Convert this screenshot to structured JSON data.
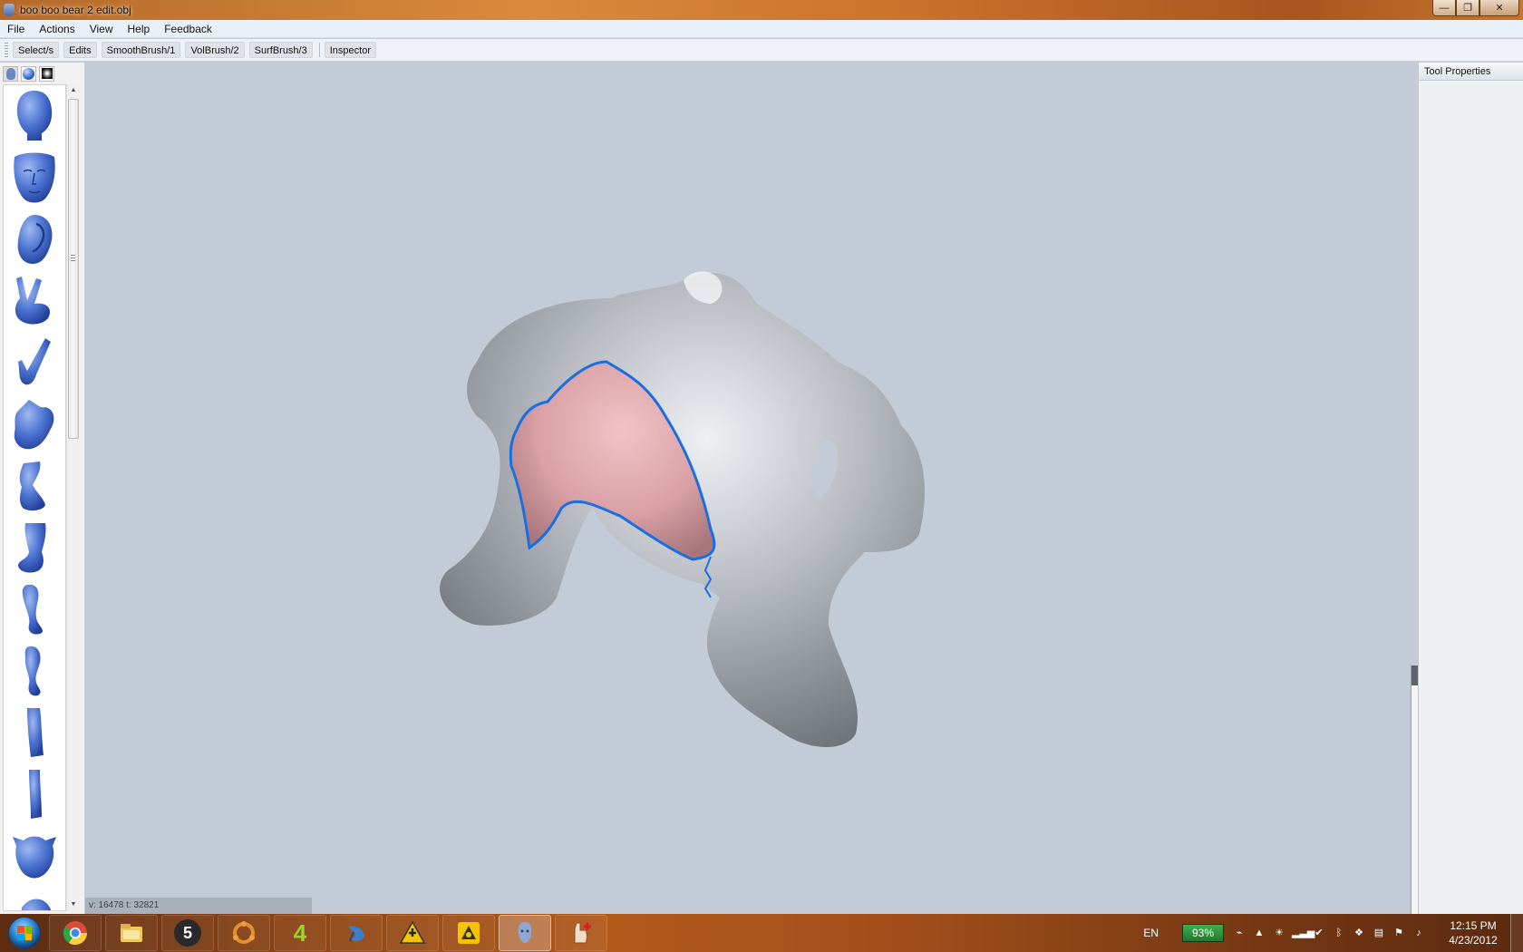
{
  "window": {
    "title": "boo boo bear 2 edit.obj",
    "minimize": "—",
    "restore": "❐",
    "close": "✕"
  },
  "menu": [
    "File",
    "Actions",
    "View",
    "Help",
    "Feedback"
  ],
  "toolbar": {
    "buttons": [
      "Select/s",
      "Edits",
      "SmoothBrush/1",
      "VolBrush/2",
      "SurfBrush/3"
    ],
    "inspector": "Inspector"
  },
  "library": {
    "tabs": [
      "head-icon",
      "sphere-icon",
      "square-icon"
    ],
    "items": [
      "head",
      "face",
      "ear",
      "hand-victory",
      "hand-point",
      "hand-flat",
      "foot-side",
      "foot-angled",
      "leg",
      "leg-bent",
      "leg-straight",
      "leg-thin",
      "cow-head",
      "partial-item"
    ]
  },
  "viewport": {
    "status": "v: 16478 t: 32821",
    "model": "3D sculpt mesh",
    "mesh_color": "#b7bcc2",
    "selection_color": "#d8a3a8",
    "outline_color": "#1a6fe0"
  },
  "right_panel": {
    "title": "Tool Properties"
  },
  "taskbar": {
    "apps": [
      {
        "name": "chrome-icon",
        "label": ""
      },
      {
        "name": "file-explorer-icon",
        "label": ""
      },
      {
        "name": "app-5-icon",
        "label": "5"
      },
      {
        "name": "ubuntu-ring-icon",
        "label": ""
      },
      {
        "name": "app-4-icon",
        "label": "4"
      },
      {
        "name": "bird-icon",
        "label": ""
      },
      {
        "name": "warning-app-icon",
        "label": ""
      },
      {
        "name": "yellow-app-icon",
        "label": ""
      },
      {
        "name": "meshmixer-icon",
        "label": ""
      },
      {
        "name": "hand-plus-icon",
        "label": ""
      }
    ],
    "language": "EN",
    "battery": "93%",
    "time": "12:15 PM",
    "date": "4/23/2012"
  }
}
